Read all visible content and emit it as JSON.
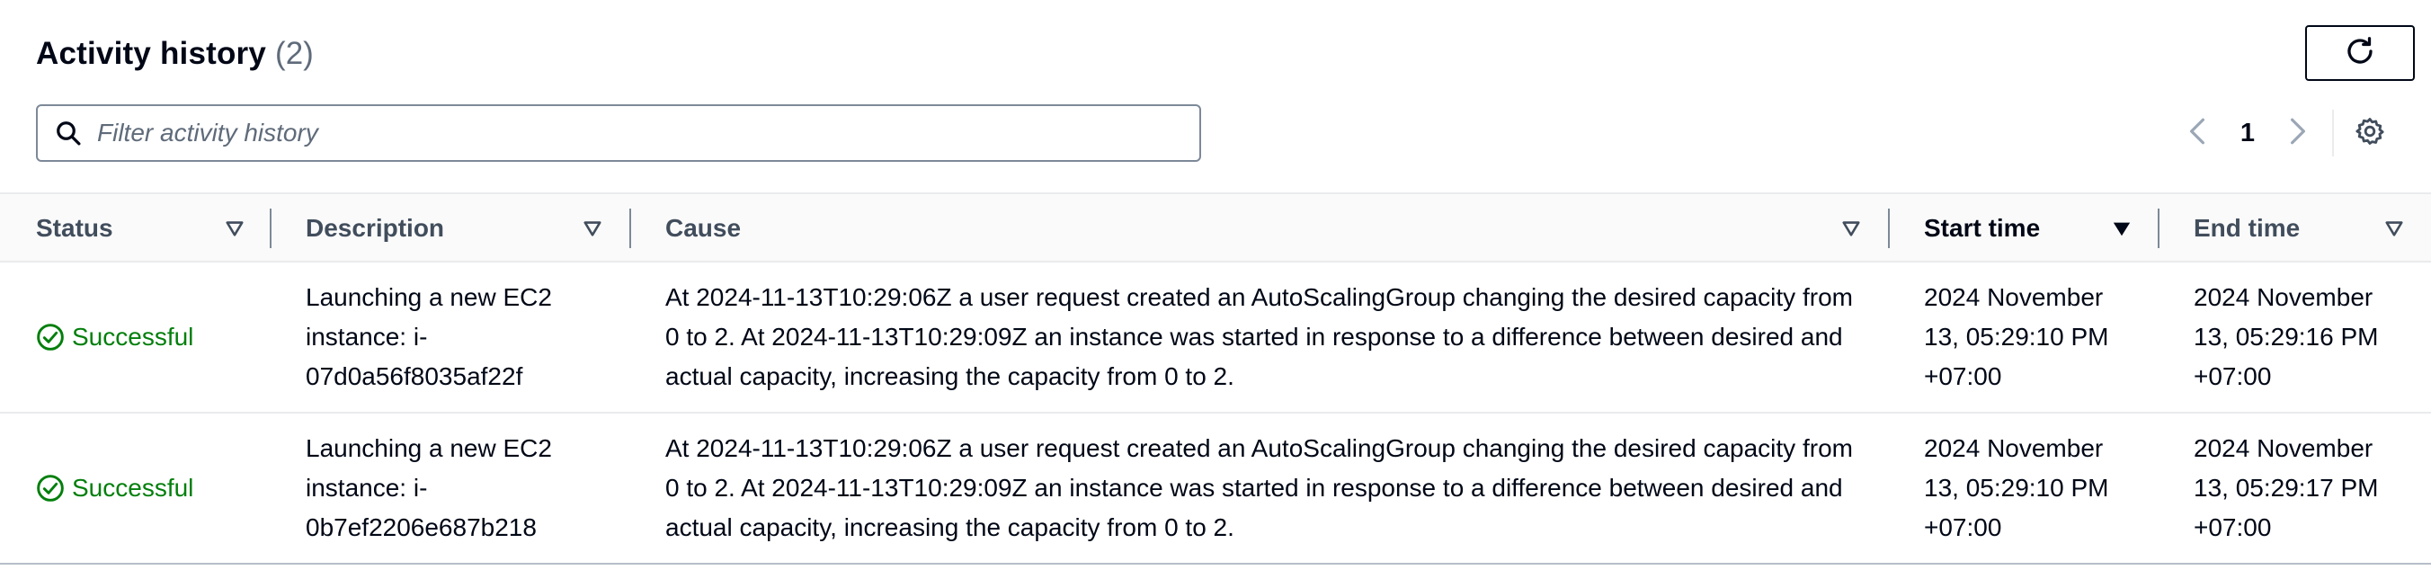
{
  "header": {
    "title": "Activity history",
    "count": "(2)",
    "refresh_icon": "refresh-icon"
  },
  "search": {
    "placeholder": "Filter activity history",
    "value": "",
    "icon": "search-icon"
  },
  "pagination": {
    "current_page": "1",
    "prev_icon": "chevron-left-icon",
    "next_icon": "chevron-right-icon",
    "settings_icon": "gear-icon"
  },
  "table": {
    "columns": [
      {
        "label": "Status",
        "sort": "none"
      },
      {
        "label": "Description",
        "sort": "none"
      },
      {
        "label": "Cause",
        "sort": "none"
      },
      {
        "label": "Start time",
        "sort": "descending"
      },
      {
        "label": "End time",
        "sort": "none"
      }
    ],
    "rows": [
      {
        "status": "Successful",
        "description": "Launching a new EC2 instance: i-07d0a56f8035af22f",
        "cause": "At 2024-11-13T10:29:06Z a user request created an AutoScalingGroup changing the desired capacity from 0 to 2. At 2024-11-13T10:29:09Z an instance was started in response to a difference between desired and actual capacity, increasing the capacity from 0 to 2.",
        "start_time": "2024 November 13, 05:29:10 PM +07:00",
        "end_time": "2024 November 13, 05:29:16 PM +07:00"
      },
      {
        "status": "Successful",
        "description": "Launching a new EC2 instance: i-0b7ef2206e687b218",
        "cause": "At 2024-11-13T10:29:06Z a user request created an AutoScalingGroup changing the desired capacity from 0 to 2. At 2024-11-13T10:29:09Z an instance was started in response to a difference between desired and actual capacity, increasing the capacity from 0 to 2.",
        "start_time": "2024 November 13, 05:29:10 PM +07:00",
        "end_time": "2024 November 13, 05:29:17 PM +07:00"
      }
    ]
  },
  "colors": {
    "success": "#037f0c",
    "text": "#000716",
    "muted": "#5f6b7a",
    "header_text": "#414d5c"
  }
}
